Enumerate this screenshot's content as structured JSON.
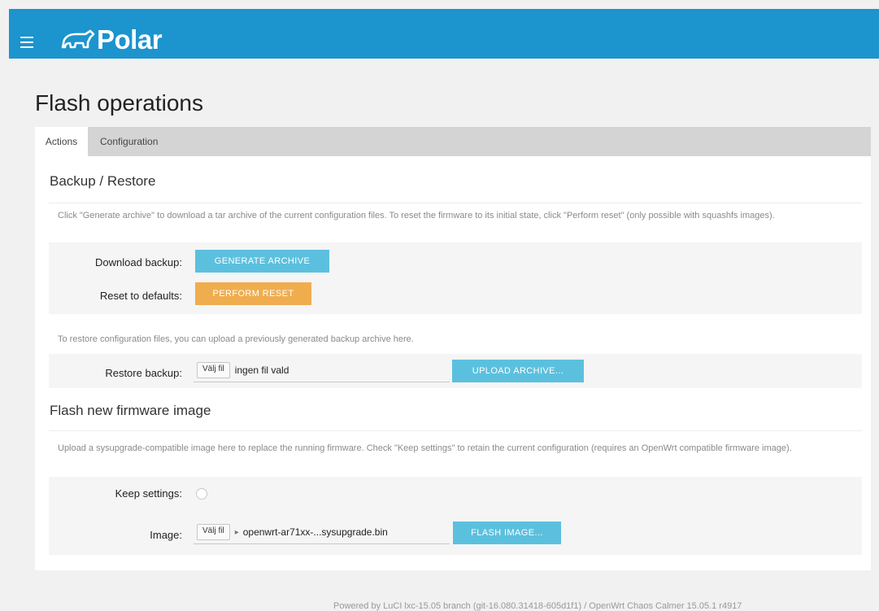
{
  "header": {
    "brand": "Polar",
    "menu_icon": "hamburger-menu-icon",
    "logo_icon": "polar-bear-logo-icon",
    "bar_color": "#1c94cd"
  },
  "page": {
    "title": "Flash operations"
  },
  "tabs": [
    {
      "label": "Actions",
      "active": true
    },
    {
      "label": "Configuration",
      "active": false
    }
  ],
  "backup": {
    "title": "Backup / Restore",
    "description": "Click \"Generate archive\" to download a tar archive of the current configuration files. To reset the firmware to its initial state, click \"Perform reset\" (only possible with squashfs images).",
    "download_label": "Download backup:",
    "generate_button": "GENERATE ARCHIVE",
    "reset_label": "Reset to defaults:",
    "reset_button": "PERFORM RESET",
    "restore_description": "To restore configuration files, you can upload a previously generated backup archive here.",
    "restore_label": "Restore backup:",
    "file_button": "Välj fil",
    "file_status": "ingen fil vald",
    "upload_button": "UPLOAD ARCHIVE..."
  },
  "flash": {
    "title": "Flash new firmware image",
    "description": "Upload a sysupgrade-compatible image here to replace the running firmware. Check \"Keep settings\" to retain the current configuration (requires an OpenWrt compatible firmware image).",
    "keep_label": "Keep settings:",
    "keep_checked": false,
    "image_label": "Image:",
    "file_button": "Välj fil",
    "file_name": "openwrt-ar71xx-...sysupgrade.bin",
    "flash_button": "FLASH IMAGE..."
  },
  "colors": {
    "info": "#5bc0de",
    "warning": "#f0ad4e"
  },
  "footer": {
    "text": "Powered by LuCI lxc-15.05 branch (git-16.080.31418-605d1f1) / OpenWrt Chaos Calmer 15.05.1 r4917"
  }
}
